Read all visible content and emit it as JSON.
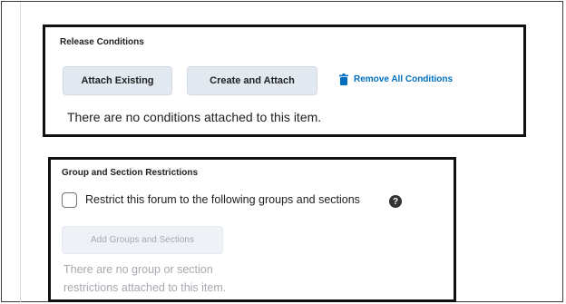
{
  "release_conditions": {
    "title": "Release Conditions",
    "attach_existing_label": "Attach Existing",
    "create_and_attach_label": "Create and Attach",
    "remove_all_label": "Remove All Conditions",
    "empty_text": "There are no conditions attached to this item."
  },
  "group_restrictions": {
    "title": "Group and Section Restrictions",
    "checkbox_label": "Restrict this forum to the following groups and sections",
    "checkbox_checked": false,
    "help_glyph": "?",
    "add_button_label": "Add Groups and Sections",
    "empty_text_line1": "There are no group or section",
    "empty_text_line2": "restrictions attached to this item."
  },
  "icons": {
    "remove_all": "trash-icon",
    "help": "help-icon"
  },
  "colors": {
    "link": "#006fbf",
    "button_bg": "#e3e9f1",
    "highlight_border": "#111111",
    "muted_text": "#a6aab0"
  }
}
